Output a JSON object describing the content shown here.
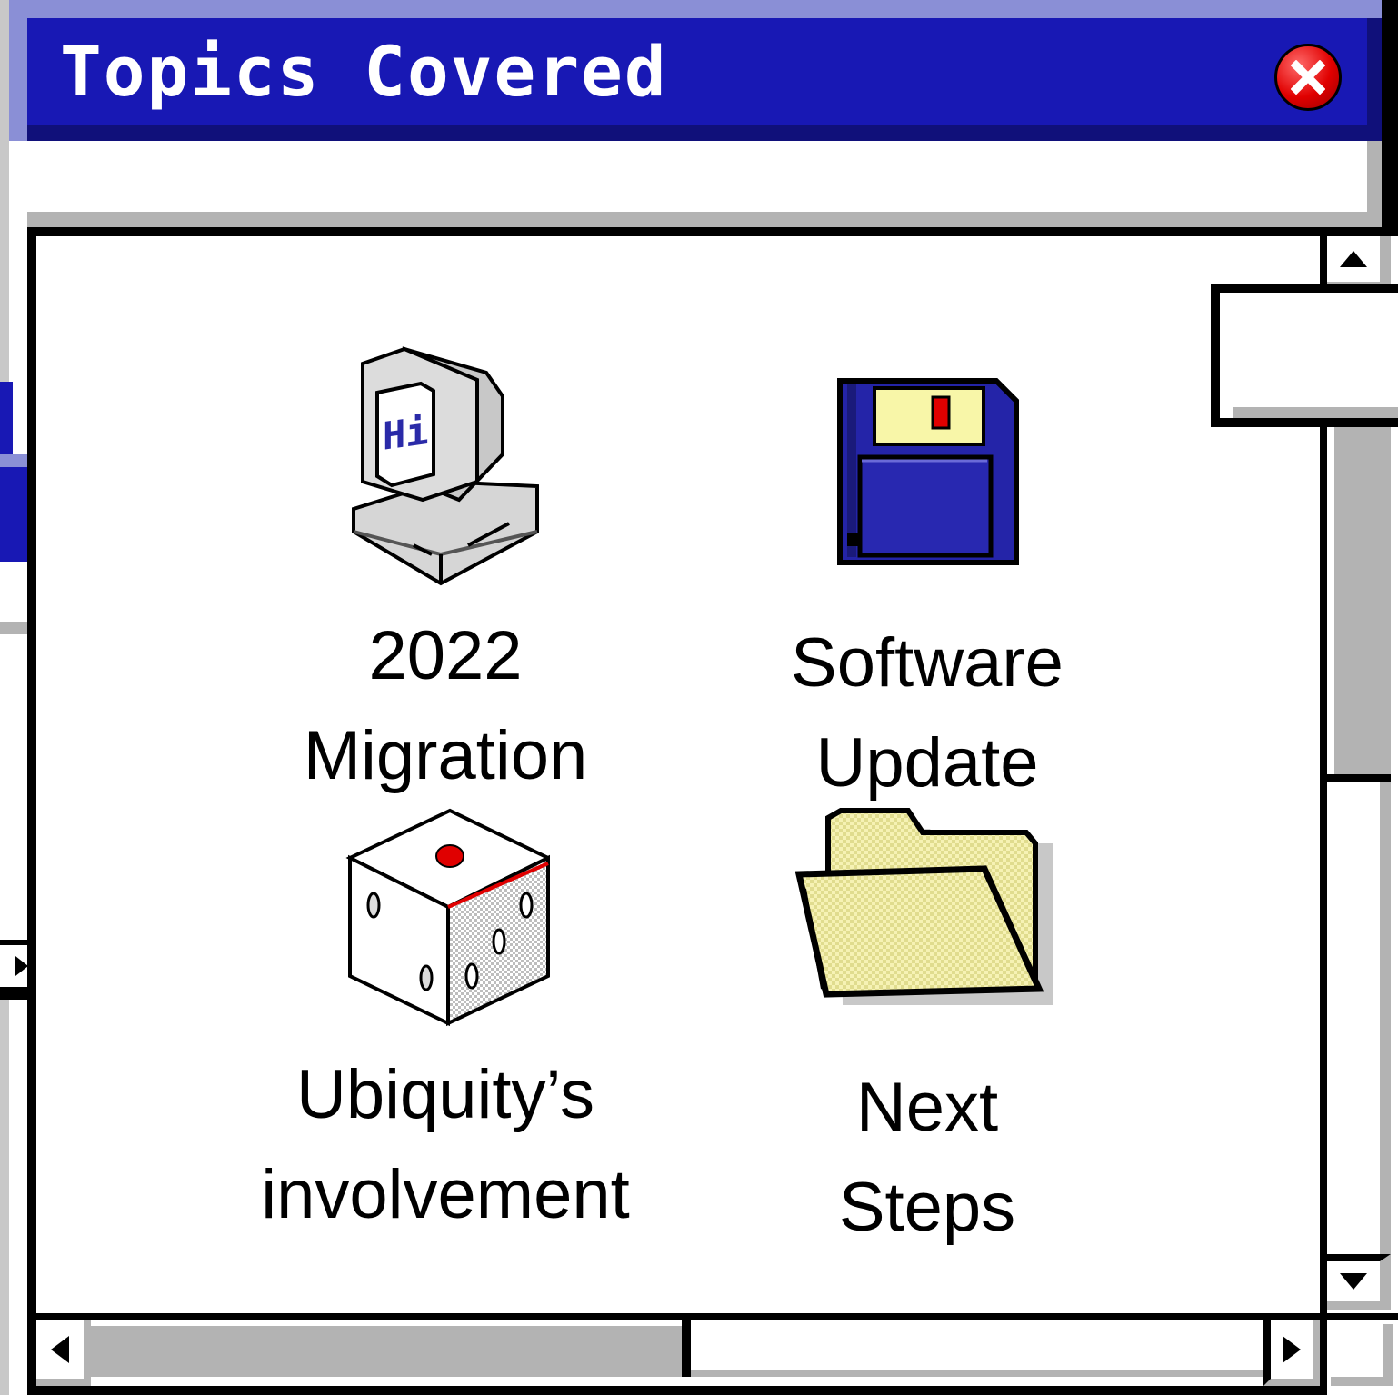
{
  "window": {
    "title": "Topics Covered"
  },
  "icons": [
    {
      "name": "computer-icon",
      "line1": "2022",
      "line2": "Migration"
    },
    {
      "name": "floppy-disk-icon",
      "line1": "Software",
      "line2": "Update"
    },
    {
      "name": "dice-icon",
      "line1": "Ubiquity’s",
      "line2": "involvement"
    },
    {
      "name": "folder-icon",
      "line1": "Next",
      "line2": "Steps"
    }
  ],
  "colors": {
    "title_bar": "#1818b4",
    "title_highlight": "#8a8fd6",
    "shadow_gray": "#b3b3b3",
    "close_red": "#e00000",
    "folder_yellow": "#f2efae",
    "floppy_blue": "#2424a8"
  }
}
